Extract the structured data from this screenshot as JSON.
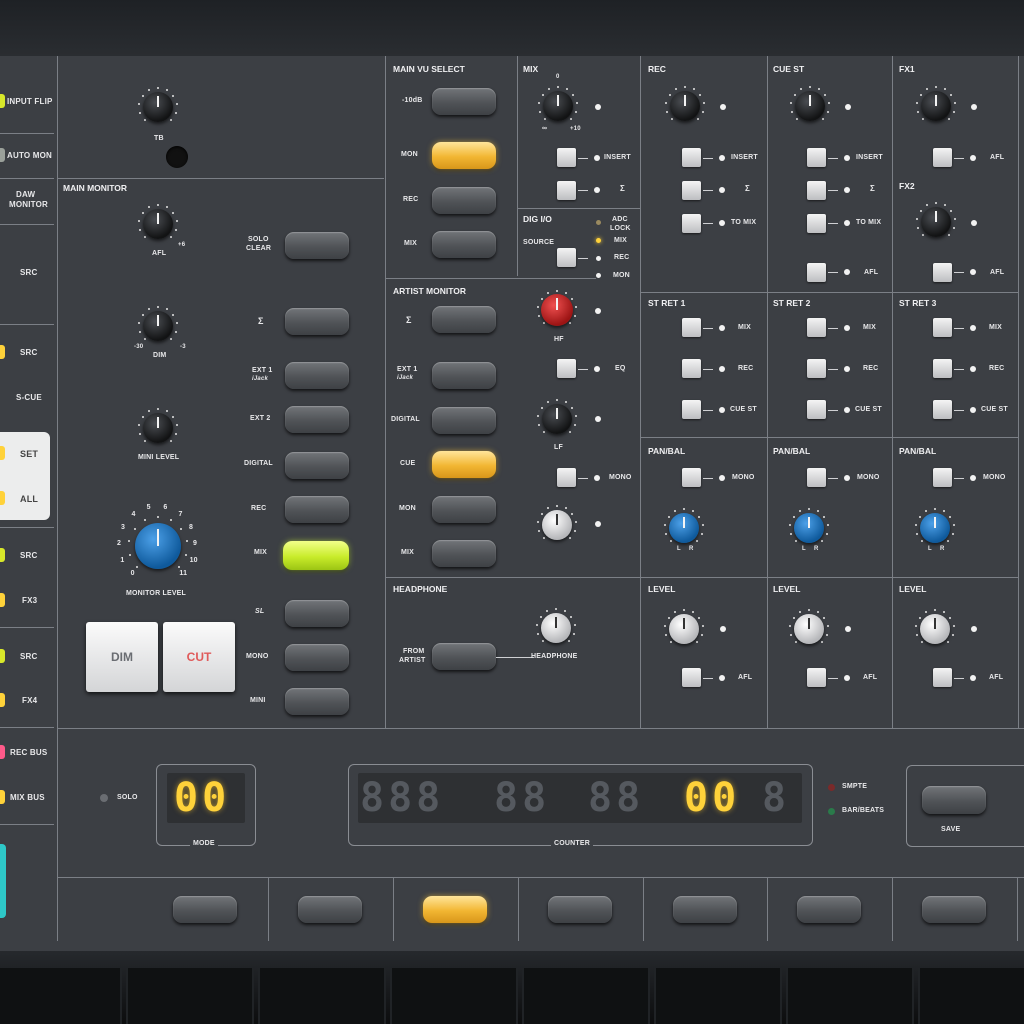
{
  "left_strip": {
    "input_flip": "INPUT FLIP",
    "auto_mon": "AUTO MON",
    "daw_monitor_1": "DAW",
    "daw_monitor_2": "MONITOR",
    "src_1": "SRC",
    "src_2": "SRC",
    "s_cue": "S-CUE",
    "set": "SET",
    "all": "ALL",
    "src_3": "SRC",
    "fx3": "FX3",
    "src_4": "SRC",
    "fx4": "FX4",
    "rec_bus": "REC BUS",
    "mix_bus": "MIX BUS"
  },
  "talkback": {
    "label": "TB"
  },
  "main_monitor": {
    "title": "MAIN MONITOR",
    "afl": "AFL",
    "afl_scale": "+6",
    "dim": "DIM",
    "dim_min": "-30",
    "dim_max": "-3",
    "mini_level": "MINI LEVEL",
    "monitor_level": "MONITOR LEVEL",
    "scale": [
      "0",
      "1",
      "2",
      "3",
      "4",
      "5",
      "6",
      "7",
      "8",
      "9",
      "10",
      "11"
    ],
    "solo_clear_1": "SOLO",
    "solo_clear_2": "CLEAR",
    "sigma": "Σ",
    "ext1": "EXT 1",
    "ijack": "iJack",
    "ext2": "EXT 2",
    "digital": "DIGITAL",
    "rec": "REC",
    "mix": "MIX",
    "sl": "SL",
    "mono": "MONO",
    "mini": "MINI",
    "dim_button": "DIM",
    "cut_button": "CUT"
  },
  "main_vu_select": {
    "title": "MAIN VU SELECT",
    "m10db": "-10dB",
    "mon": "MON",
    "rec": "REC",
    "mix": "MIX"
  },
  "mix_section": {
    "title": "MIX",
    "zero": "0",
    "inf": "∞",
    "plus10": "+10",
    "insert": "INSERT",
    "sigma": "Σ"
  },
  "dig_io": {
    "title": "DIG I/O",
    "source": "SOURCE",
    "adc_lock_1": "ADC",
    "adc_lock_2": "LOCK",
    "mix": "MIX",
    "rec": "REC",
    "mon": "MON"
  },
  "artist_monitor": {
    "title": "ARTIST MONITOR",
    "sigma": "Σ",
    "ext1": "EXT 1",
    "ijack": "iJack",
    "digital": "DIGITAL",
    "cue": "CUE",
    "mon": "MON",
    "mix": "MIX",
    "hf": "HF",
    "eq": "EQ",
    "lf": "LF",
    "mono": "MONO"
  },
  "headphone": {
    "title": "HEADPHONE",
    "from_artist_1": "FROM",
    "from_artist_2": "ARTIST",
    "headphone": "HEADPHONE"
  },
  "rec_section": {
    "title": "REC",
    "insert": "INSERT",
    "sigma": "Σ",
    "to_mix": "TO MIX"
  },
  "cue_st_section": {
    "title": "CUE ST",
    "insert": "INSERT",
    "sigma": "Σ",
    "to_mix": "TO MIX",
    "afl": "AFL"
  },
  "fx_section": {
    "fx1": "FX1",
    "fx2": "FX2",
    "afl": "AFL"
  },
  "st_ret": [
    {
      "title": "ST RET 1",
      "mix": "MIX",
      "rec": "REC",
      "cue_st": "CUE ST",
      "pan_bal": "PAN/BAL",
      "mono": "MONO",
      "level": "LEVEL",
      "afl": "AFL",
      "l": "L",
      "r": "R"
    },
    {
      "title": "ST RET 2",
      "mix": "MIX",
      "rec": "REC",
      "cue_st": "CUE ST",
      "pan_bal": "PAN/BAL",
      "mono": "MONO",
      "level": "LEVEL",
      "afl": "AFL",
      "l": "L",
      "r": "R"
    },
    {
      "title": "ST RET 3",
      "mix": "MIX",
      "rec": "REC",
      "cue_st": "CUE ST",
      "pan_bal": "PAN/BAL",
      "mono": "MONO",
      "level": "LEVEL",
      "afl": "AFL",
      "l": "L",
      "r": "R"
    }
  ],
  "transport": {
    "solo": "SOLO",
    "mode_display": "00",
    "mode": "MODE",
    "counter_dim_1": "888",
    "counter_dim_2": "88",
    "counter_dim_3": "88",
    "counter_lit": "00",
    "counter_dim_4": "8",
    "counter": "COUNTER",
    "smpte": "SMPTE",
    "bar_beats": "BAR/BEATS",
    "save": "SAVE"
  },
  "colors": {
    "panel": "#3c3f44",
    "led_yellow": "#ffd23a",
    "knob_blue": "#1a6fb8",
    "knob_red": "#d42424",
    "button_lime": "#c8ec2a",
    "cut_red": "#e05a5a"
  }
}
